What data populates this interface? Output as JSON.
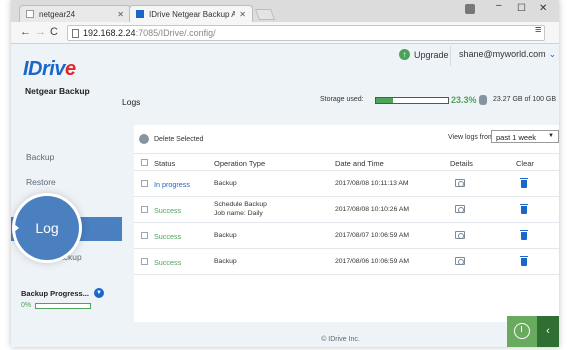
{
  "browser": {
    "tabs": [
      {
        "label": "netgear24",
        "close": "✕"
      },
      {
        "label": "IDrive Netgear Backup Ap",
        "close": "✕"
      }
    ],
    "url_host": "192.168.2.24",
    "url_path": ":7085/IDrive/.config/",
    "window_controls": {
      "minimize": "–",
      "maximize": "☐",
      "close": "✕"
    },
    "nav": {
      "back": "←",
      "forward": "→",
      "reload": "C"
    },
    "star": "☆",
    "menu": "≡"
  },
  "header": {
    "upgrade_label": "Upgrade",
    "account": "shane@myworld.com",
    "account_chevron": "⌄"
  },
  "sidebar": {
    "logo_main": "IDriv",
    "logo_e": "e",
    "logo_sub": "Netgear Backup",
    "items": [
      {
        "label": "Backup"
      },
      {
        "label": "Restore"
      },
      {
        "label": "Log"
      },
      {
        "label": "ackup"
      }
    ],
    "magnified_label": "Log",
    "progress_label": "Backup Progress...",
    "progress_percent_text": "0%",
    "progress_value": 0
  },
  "main": {
    "title": "Logs",
    "storage_label": "Storage used:",
    "storage_percent": "23.3%",
    "storage_fraction": 0.233,
    "storage_total": "23.27 GB of 100 GB",
    "delete_selected": "Delete Selected",
    "view_logs_from": "View logs from",
    "view_select_value": "past 1 week",
    "columns": [
      "Status",
      "Operation Type",
      "Date and Time",
      "Details",
      "Clear"
    ],
    "rows": [
      {
        "status": "In progress",
        "op": "Backup",
        "op2": "",
        "date": "2017/08/08 10:11:13 AM"
      },
      {
        "status": "Success",
        "op": "Schedule Backup",
        "op2": "Job name: Daily",
        "date": "2017/08/08 10:10:26 AM"
      },
      {
        "status": "Success",
        "op": "Backup",
        "op2": "",
        "date": "2017/08/07 10:06:59 AM"
      },
      {
        "status": "Success",
        "op": "Backup",
        "op2": "",
        "date": "2017/08/06 10:06:59 AM"
      }
    ],
    "footer": "© IDrive Inc."
  },
  "colors": {
    "brand_blue": "#1b66c9",
    "success_green": "#4ea35a",
    "sidebar_bg": "#eef3f7",
    "active_item": "#4a7fc0"
  },
  "floating": {
    "collapse": "‹"
  }
}
